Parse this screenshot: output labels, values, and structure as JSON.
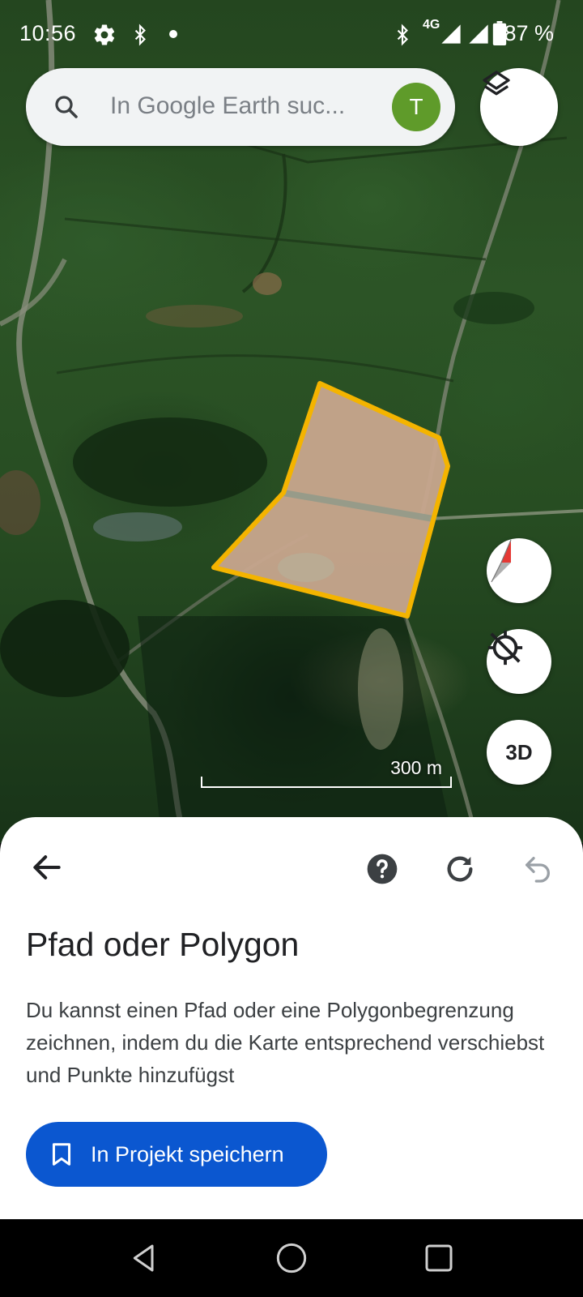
{
  "status_bar": {
    "time": "10:56",
    "network": "4G",
    "battery": "87 %"
  },
  "search": {
    "placeholder": "In Google Earth suc...",
    "avatar_letter": "T"
  },
  "map": {
    "scale_label": "300 m",
    "three_d_label": "3D",
    "polygon_color": "#f4b400"
  },
  "sheet": {
    "title": "Pfad oder Polygon",
    "description": "Du kannst einen Pfad oder eine Polygonbegrenzung zeichnen, indem du die Karte entsprechend verschiebst und Punkte hinzufügst",
    "save_button": "In Projekt speichern"
  },
  "icons": [
    "gear-icon",
    "bluetooth-icon",
    "dot-icon",
    "signal-icon",
    "battery-icon",
    "search-icon",
    "layers-icon",
    "compass-icon",
    "location-off-icon",
    "back-arrow-icon",
    "help-icon",
    "redo-icon",
    "undo-icon",
    "bookmark-icon",
    "nav-back-icon",
    "nav-home-icon",
    "nav-recents-icon"
  ],
  "colors": {
    "primary_button": "#0b57d0",
    "avatar": "#5f9b2a"
  }
}
